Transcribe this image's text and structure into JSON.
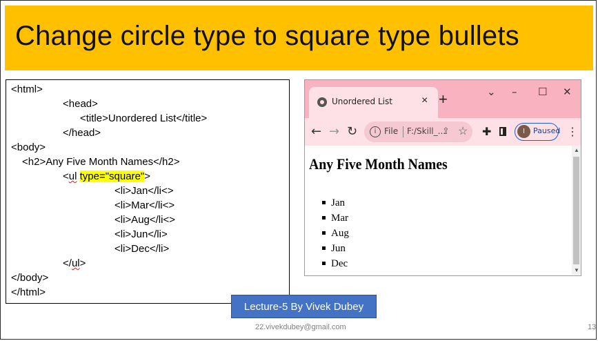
{
  "slide": {
    "title": "Change circle type to square type bullets",
    "lecture_badge": "Lecture-5 By Vivek Dubey",
    "footer_email": "22.vivekdubey@gmail.com",
    "page_number": "13",
    "colors": {
      "title_band": "#ffc000",
      "badge": "#4472c4",
      "highlight": "#ffff00"
    }
  },
  "code": {
    "html_open": "<html>",
    "head_open": "<head>",
    "title_line": "<title>Unordered List</title>",
    "head_close": "</head>",
    "body_open": "<body>",
    "h2_line": "<h2>Any Five Month Names</h2>",
    "ul_prefix": "<",
    "ul_tag": "ul",
    "ul_attr": "type=\"square\"",
    "ul_suffix": ">",
    "li_items": [
      "<li>Jan</li<>",
      "<li>Mar</li<>",
      "<li>Aug</li<>",
      "<li>Jun</li>",
      "<li>Dec</li>"
    ],
    "ul_close_prefix": "</",
    "ul_close_tag": "ul",
    "ul_close_suffix": ">",
    "body_close": "</body>",
    "html_close": "</html>"
  },
  "browser": {
    "tab_title": "Unordered List",
    "tab_close": "×",
    "new_tab": "+",
    "window_controls": {
      "dropdown": "⌄",
      "minimize": "–",
      "maximize": "☐",
      "close": "✕"
    },
    "nav": {
      "back": "←",
      "forward": "→",
      "reload": "↻"
    },
    "info_icon": "i",
    "scheme_label": "File",
    "url": "F:/Skill_...",
    "profile_initial": "I",
    "profile_status": "Paused",
    "page": {
      "heading": "Any Five Month Names",
      "list_type": "square",
      "items": [
        "Jan",
        "Mar",
        "Aug",
        "Jun",
        "Dec"
      ]
    }
  }
}
